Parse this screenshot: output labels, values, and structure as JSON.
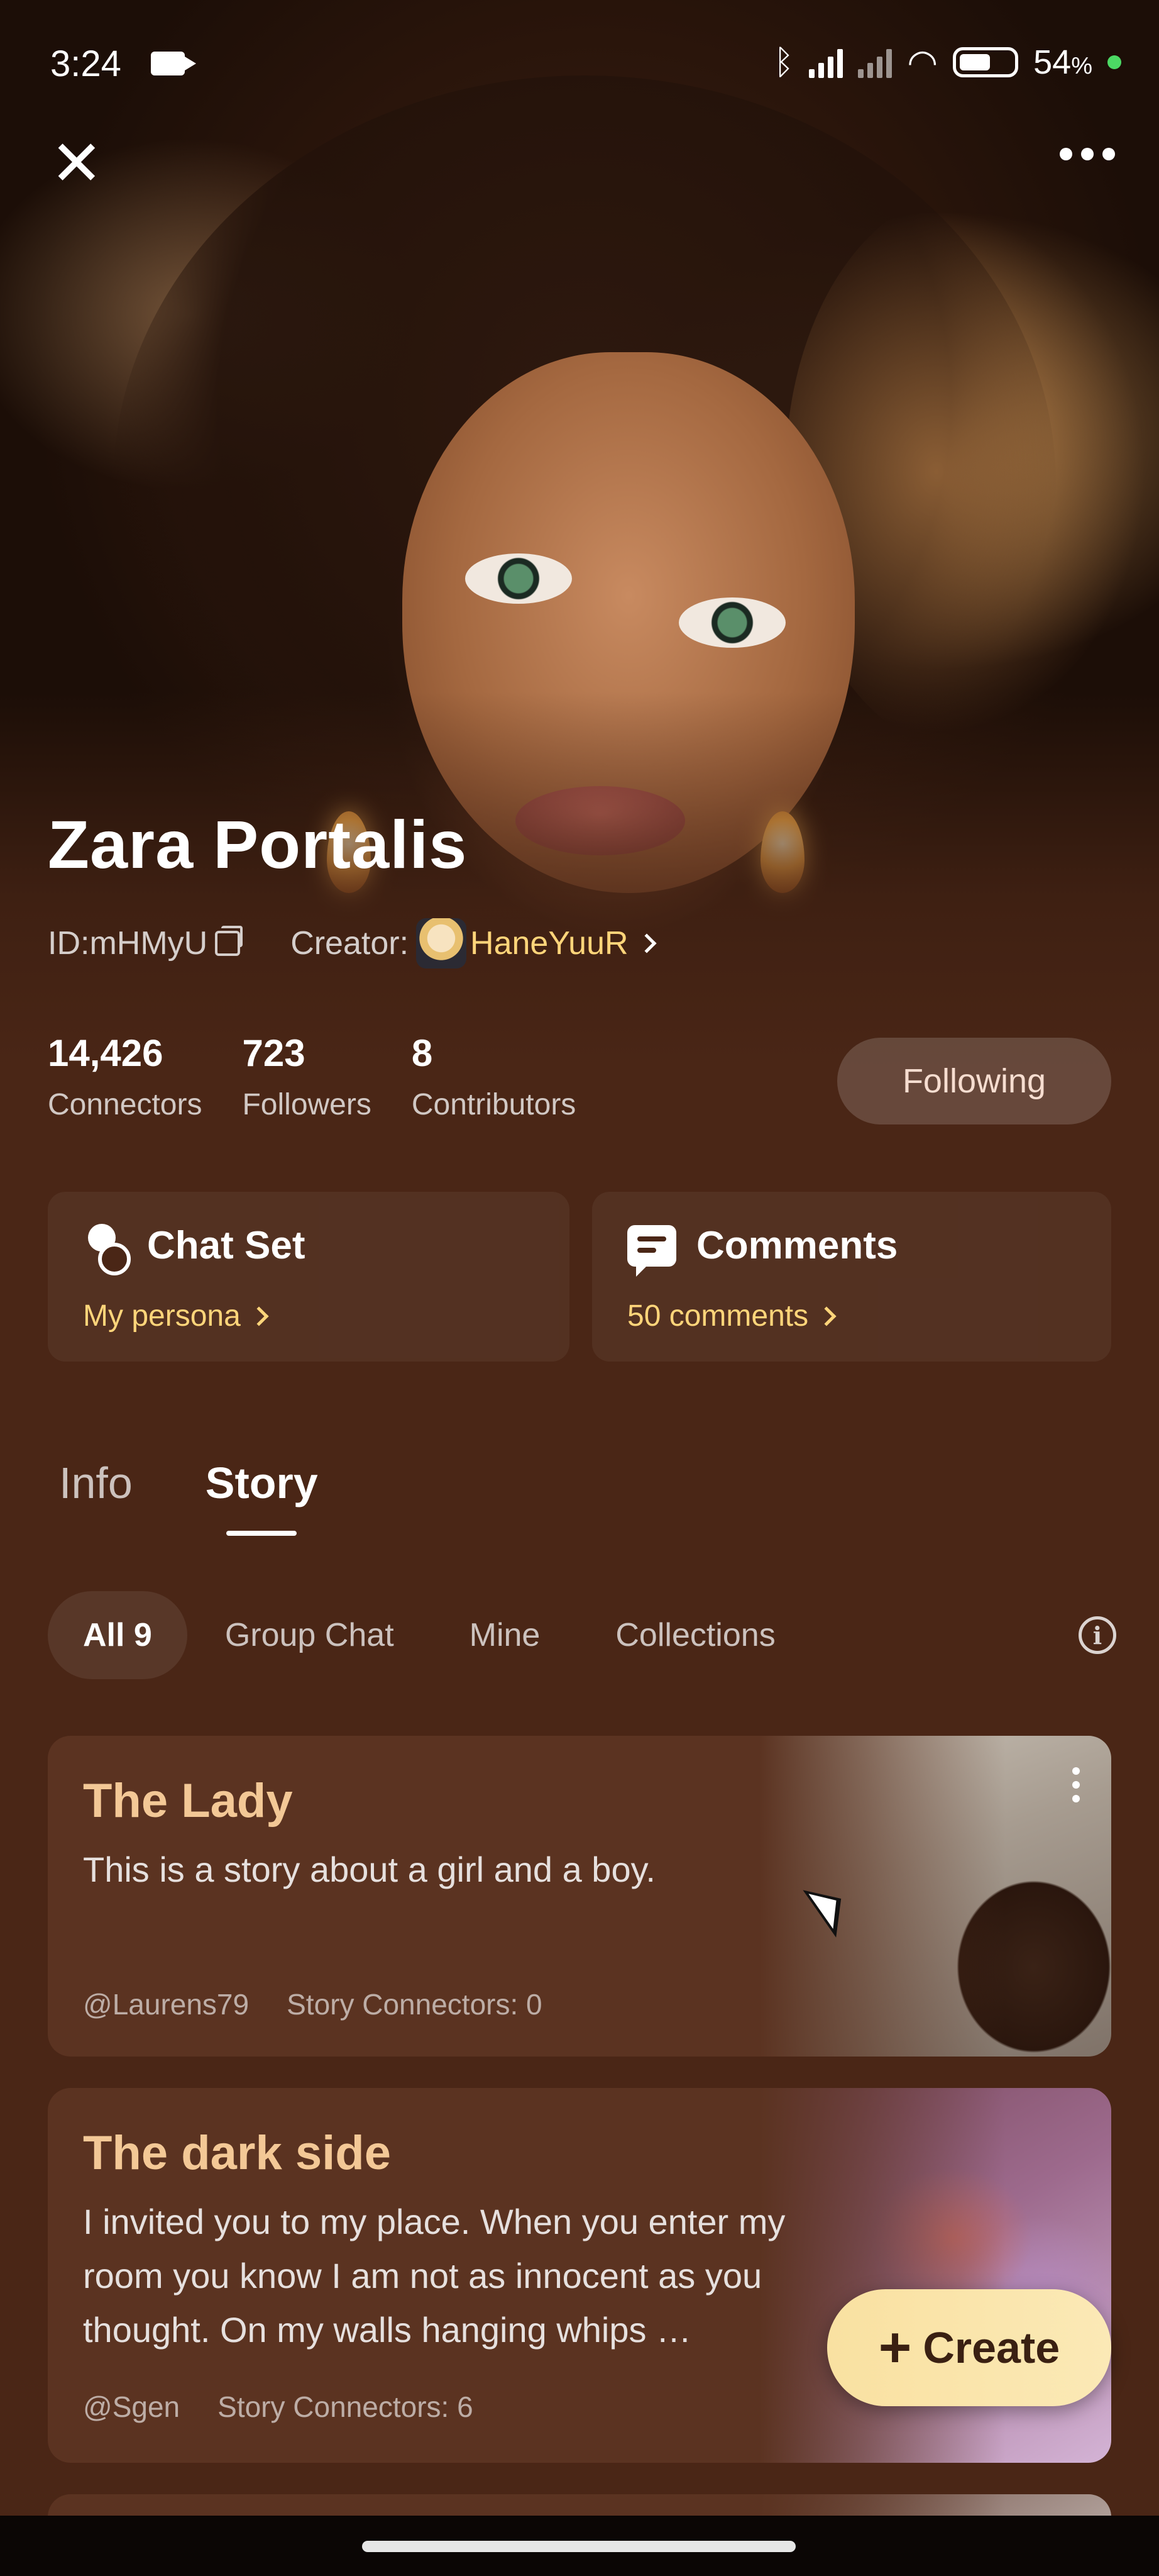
{
  "status_bar": {
    "time": "3:24",
    "battery_pct": "54",
    "battery_suffix": "%",
    "icons": [
      "video-camera-icon",
      "bluetooth-icon",
      "signal-icon",
      "wifi-icon",
      "battery-icon"
    ]
  },
  "character": {
    "name": "Zara Portalis",
    "id_label": "ID:mHMyU",
    "creator_label": "Creator:",
    "creator_name": "HaneYuuR"
  },
  "stats": [
    {
      "value": "14,426",
      "label": "Connectors"
    },
    {
      "value": "723",
      "label": "Followers"
    },
    {
      "value": "8",
      "label": "Contributors"
    }
  ],
  "follow_button": "Following",
  "cards": {
    "chat_set": {
      "title": "Chat Set",
      "link": "My persona"
    },
    "comments": {
      "title": "Comments",
      "link": "50 comments"
    }
  },
  "tabs": [
    {
      "label": "Info",
      "active": false
    },
    {
      "label": "Story",
      "active": true
    }
  ],
  "filters": [
    {
      "label": "All 9",
      "active": true
    },
    {
      "label": "Group Chat",
      "active": false
    },
    {
      "label": "Mine",
      "active": false
    },
    {
      "label": "Collections",
      "active": false
    }
  ],
  "stories": [
    {
      "title": "The Lady",
      "description": "This is a story about a girl and a boy.",
      "author": "@Laurens79",
      "connectors": "Story Connectors: 0"
    },
    {
      "title": "The dark side",
      "description": "I invited you to my place. When you enter my room you know I am not as innocent as you thought. On my walls hanging whips …",
      "author": "@Sgen",
      "connectors": "Story Connectors: 6"
    }
  ],
  "create_button": "Create",
  "colors": {
    "background": "#4a2616",
    "accent_gold": "#ffd57a",
    "story_title": "#f3c896",
    "create_button": "#f9e1a1"
  }
}
